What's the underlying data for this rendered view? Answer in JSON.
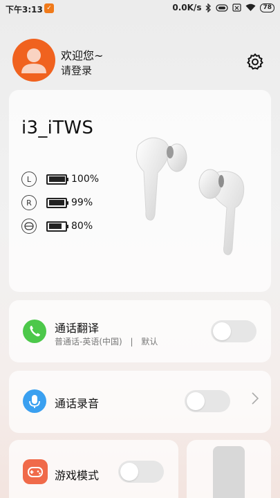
{
  "status_bar": {
    "time": "下午3:13",
    "network_speed": "0.0K/s",
    "battery": "78"
  },
  "header": {
    "greeting": "欢迎您~",
    "login_prompt": "请登录"
  },
  "device": {
    "name": "i3_iTWS",
    "batteries": [
      {
        "tag": "L",
        "percent": "100%",
        "level": 1.0
      },
      {
        "tag": "R",
        "percent": "99%",
        "level": 0.99
      },
      {
        "tag": "case",
        "percent": "80%",
        "level": 0.8
      }
    ]
  },
  "features": {
    "call_translate": {
      "title": "通话翻译",
      "subtitle": "普通话-英语(中国)",
      "divider": "|",
      "mode": "默认",
      "enabled": false
    },
    "call_record": {
      "title": "通话录音",
      "enabled": false
    },
    "game_mode": {
      "title": "游戏模式",
      "enabled": false
    }
  },
  "colors": {
    "avatar": "#f0621f",
    "translate_icon": "#4cc84a",
    "record_icon": "#3aa0f0",
    "game_icon": "#f06a4a"
  }
}
